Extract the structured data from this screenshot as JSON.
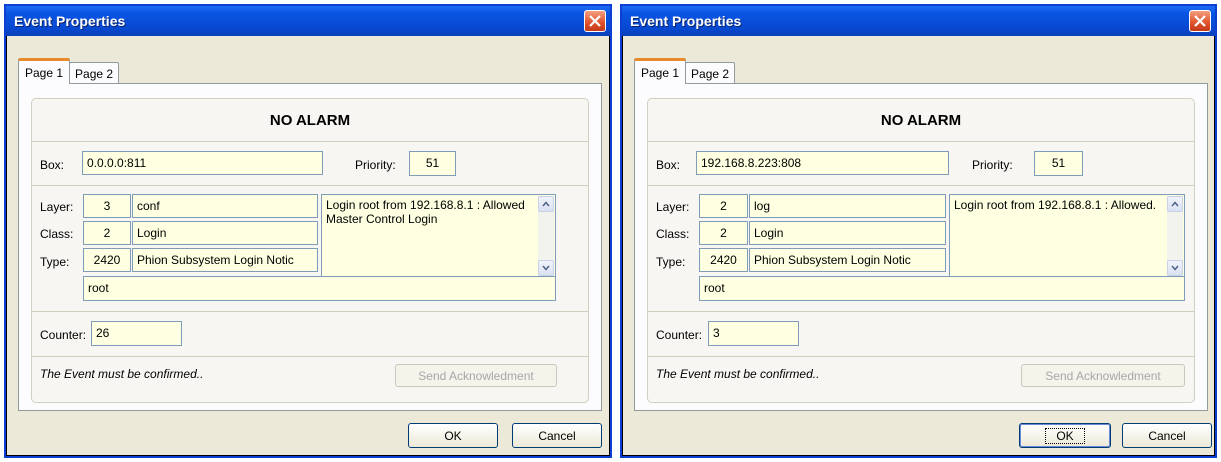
{
  "dialogs": [
    {
      "title": "Event Properties",
      "tabs": [
        "Page 1",
        "Page 2"
      ],
      "status": "NO ALARM",
      "box_label": "Box:",
      "box_value": "0.0.0.0:811",
      "priority_label": "Priority:",
      "priority_value": "51",
      "layer_label": "Layer:",
      "layer_num": "3",
      "layer_name": "conf",
      "class_label": "Class:",
      "class_num": "2",
      "class_name": "Login",
      "type_label": "Type:",
      "type_num": "2420",
      "type_name": "Phion Subsystem Login Notic",
      "message": "Login root from 192.168.8.1 : Allowed Master Control Login",
      "user": "root",
      "counter_label": "Counter:",
      "counter_value": "26",
      "confirm_text": "The Event must be confirmed..",
      "send_ack": "Send Acknowledment",
      "ok": "OK",
      "cancel": "Cancel"
    },
    {
      "title": "Event Properties",
      "tabs": [
        "Page 1",
        "Page 2"
      ],
      "status": "NO ALARM",
      "box_label": "Box:",
      "box_value": "192.168.8.223:808",
      "priority_label": "Priority:",
      "priority_value": "51",
      "layer_label": "Layer:",
      "layer_num": "2",
      "layer_name": "log",
      "class_label": "Class:",
      "class_num": "2",
      "class_name": "Login",
      "type_label": "Type:",
      "type_num": "2420",
      "type_name": "Phion Subsystem Login Notic",
      "message": "Login root from 192.168.8.1 : Allowed.",
      "user": "root",
      "counter_label": "Counter:",
      "counter_value": "3",
      "confirm_text": "The Event must be confirmed..",
      "send_ack": "Send Acknowledment",
      "ok": "OK",
      "cancel": "Cancel"
    }
  ],
  "colors": {
    "titlebar": "#0a55e3",
    "close_button": "#e0512a",
    "field_background": "#ffffe1",
    "dialog_background": "#ece9d8",
    "active_tab_accent": "#e68b2c"
  }
}
